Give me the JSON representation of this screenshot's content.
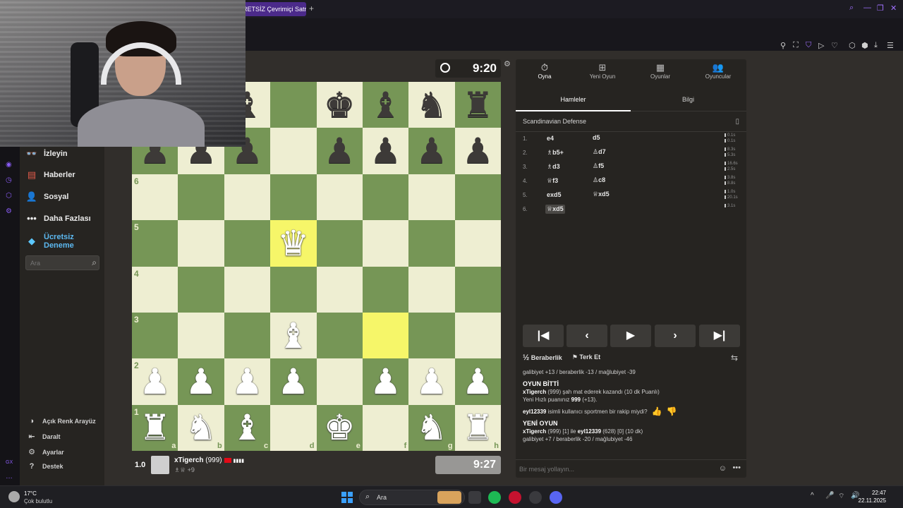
{
  "browser": {
    "tab_title": "RETSİZ Çevrimiçi Satra",
    "new_tab": "+"
  },
  "sidebar": {
    "items": [
      {
        "label": "İzleyin",
        "icon": "binoculars-icon"
      },
      {
        "label": "Haberler",
        "icon": "news-icon"
      },
      {
        "label": "Sosyal",
        "icon": "social-icon"
      },
      {
        "label": "Daha Fazlası",
        "icon": "more-dots-icon"
      },
      {
        "label": "Ücretsiz Deneme",
        "icon": "diamond-icon"
      }
    ],
    "search_placeholder": "Ara",
    "bottom": [
      {
        "label": "Açık Renk Arayüz",
        "icon": "sun-icon"
      },
      {
        "label": "Daralt",
        "icon": "collapse-icon"
      },
      {
        "label": "Ayarlar",
        "icon": "gear-icon"
      },
      {
        "label": "Destek",
        "icon": "help-icon"
      }
    ]
  },
  "top_clock": "9:20",
  "board": {
    "ranks": [
      "8",
      "7",
      "6",
      "5",
      "4",
      "3",
      "2",
      "1"
    ],
    "files": [
      "a",
      "b",
      "c",
      "d",
      "e",
      "f",
      "g",
      "h"
    ],
    "highlights": [
      "d5",
      "f3"
    ],
    "pieces": [
      {
        "sq": "c8",
        "glyph": "♝",
        "color": "b"
      },
      {
        "sq": "e8",
        "glyph": "♚",
        "color": "b"
      },
      {
        "sq": "f8",
        "glyph": "♝",
        "color": "b"
      },
      {
        "sq": "g8",
        "glyph": "♞",
        "color": "b"
      },
      {
        "sq": "h8",
        "glyph": "♜",
        "color": "b"
      },
      {
        "sq": "a7",
        "glyph": "♟",
        "color": "b"
      },
      {
        "sq": "b7",
        "glyph": "♟",
        "color": "b"
      },
      {
        "sq": "c7",
        "glyph": "♟",
        "color": "b"
      },
      {
        "sq": "e7",
        "glyph": "♟",
        "color": "b"
      },
      {
        "sq": "f7",
        "glyph": "♟",
        "color": "b"
      },
      {
        "sq": "g7",
        "glyph": "♟",
        "color": "b"
      },
      {
        "sq": "h7",
        "glyph": "♟",
        "color": "b"
      },
      {
        "sq": "d5",
        "glyph": "♛",
        "color": "w"
      },
      {
        "sq": "d3",
        "glyph": "♝",
        "color": "w"
      },
      {
        "sq": "a2",
        "glyph": "♟",
        "color": "w"
      },
      {
        "sq": "b2",
        "glyph": "♟",
        "color": "w"
      },
      {
        "sq": "c2",
        "glyph": "♟",
        "color": "w"
      },
      {
        "sq": "d2",
        "glyph": "♟",
        "color": "w"
      },
      {
        "sq": "f2",
        "glyph": "♟",
        "color": "w"
      },
      {
        "sq": "g2",
        "glyph": "♟",
        "color": "w"
      },
      {
        "sq": "h2",
        "glyph": "♟",
        "color": "w"
      },
      {
        "sq": "a1",
        "glyph": "♜",
        "color": "w"
      },
      {
        "sq": "b1",
        "glyph": "♞",
        "color": "w"
      },
      {
        "sq": "c1",
        "glyph": "♝",
        "color": "w"
      },
      {
        "sq": "e1",
        "glyph": "♚",
        "color": "w"
      },
      {
        "sq": "g1",
        "glyph": "♞",
        "color": "w"
      },
      {
        "sq": "h1",
        "glyph": "♜",
        "color": "w"
      }
    ]
  },
  "player": {
    "score": "1.0",
    "name": "xTigerch",
    "rating": "(999)",
    "captured": "♗♕ +9",
    "clock": "9:27"
  },
  "panel": {
    "tabs": [
      {
        "label": "Oyna",
        "icon": "stopwatch-icon"
      },
      {
        "label": "Yeni Oyun",
        "icon": "plus-square-icon"
      },
      {
        "label": "Oyunlar",
        "icon": "board-icon"
      },
      {
        "label": "Oyuncular",
        "icon": "players-icon"
      }
    ],
    "subtabs": [
      "Hamleler",
      "Bilgi"
    ],
    "opening": "Scandinavian Defense",
    "moves": [
      {
        "n": "1.",
        "w": "e4",
        "b": "d5",
        "t1": "0.1s",
        "t2": "0.1s"
      },
      {
        "n": "2.",
        "w": "♗b5+",
        "b": "♙d7",
        "t1": "8.3s",
        "t2": "5.3s"
      },
      {
        "n": "3.",
        "w": "♗d3",
        "b": "♙f5",
        "t1": "16.6s",
        "t2": "2.5s"
      },
      {
        "n": "4.",
        "w": "♕f3",
        "b": "♙c8",
        "t1": "3.8s",
        "t2": "8.8s"
      },
      {
        "n": "5.",
        "w": "exd5",
        "b": "♕xd5",
        "t1": "1.0s",
        "t2": "20.1s"
      },
      {
        "n": "6.",
        "w": "♕xd5",
        "b": "",
        "t1": "3.1s",
        "t2": ""
      }
    ],
    "nav": [
      "first-icon",
      "prev-icon",
      "play-icon",
      "next-icon",
      "last-icon"
    ],
    "draw_label": "Beraberlik",
    "draw_prefix": "½",
    "resign_label": "Terk Et",
    "chat": {
      "line0": "galibiyet +13 / beraberlik -13 / mağlubiyet -39",
      "h1": "OYUN BİTTİ",
      "l1a": "xTigerch",
      "l1b": " (999) şah mat ederek kazandı (10 dk Puanlı)",
      "l2a": "Yeni Hızlı puanınız ",
      "l2b": "999",
      "l2c": " (+13).",
      "q_user": "eyl12339",
      "q_text": " isimli kullanıcı sportmen bir rakip miydi?",
      "h2": "YENİ OYUN",
      "l3a": "xTigerch",
      "l3b": " (999) [1] ile ",
      "l3c": "eyl12339",
      "l3d": " (628) [0] (10 dk)",
      "l4": "galibiyet +7 / beraberlik -20 / mağlubiyet -46"
    },
    "chat_placeholder": "Bir mesaj yollayın..."
  },
  "taskbar": {
    "temp": "17°C",
    "weather": "Çok bulutlu",
    "search": "Ara",
    "time": "22:47",
    "date": "22.11.2025"
  },
  "colors": {
    "light_square": "#eeeed2",
    "dark_square": "#769656",
    "highlight": "#f6f669",
    "accent": "#8a5cf6"
  }
}
